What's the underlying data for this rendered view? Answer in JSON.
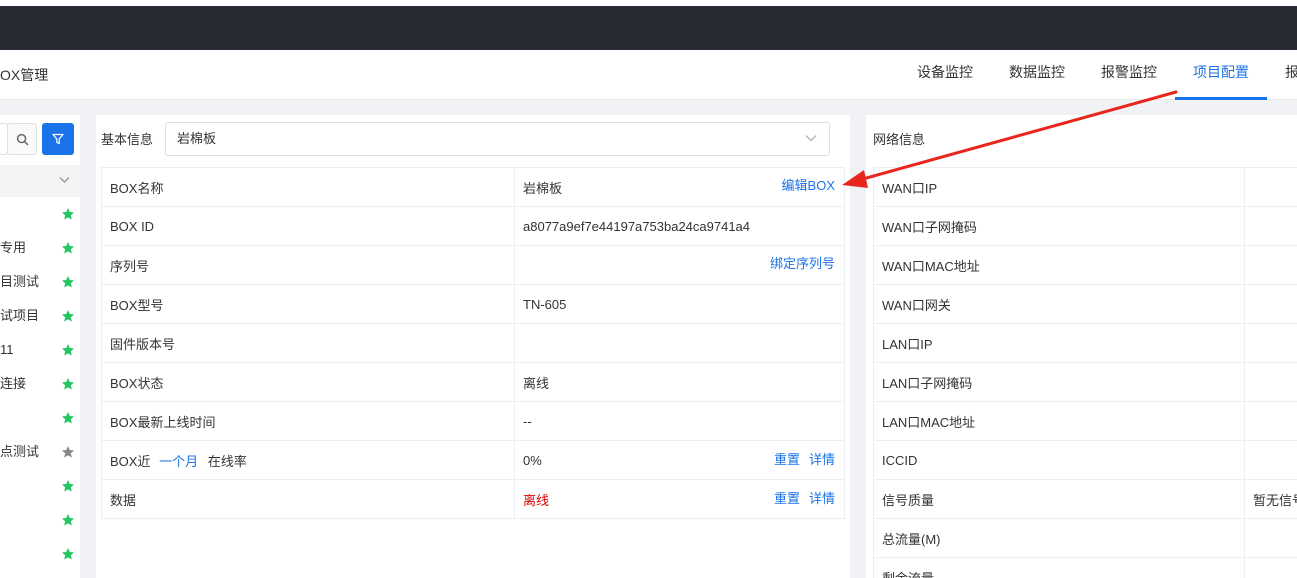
{
  "header": {
    "page_title": "OX管理",
    "tabs": [
      {
        "label": "设备监控"
      },
      {
        "label": "数据监控"
      },
      {
        "label": "报警监控"
      },
      {
        "label": "项目配置"
      },
      {
        "label": "报"
      }
    ],
    "active_tab": "项目配置",
    "accent_color": "#1a73e8"
  },
  "sidebar": {
    "projects": [
      {
        "name": "",
        "star": "green"
      },
      {
        "name": "专用",
        "star": "green"
      },
      {
        "name": "目测试",
        "star": "green"
      },
      {
        "name": "试项目",
        "star": "green"
      },
      {
        "name": "11",
        "star": "green"
      },
      {
        "name": "连接",
        "star": "green"
      },
      {
        "name": "",
        "star": "green"
      },
      {
        "name": "点测试",
        "star": "gray"
      },
      {
        "name": "",
        "star": "green"
      },
      {
        "name": "",
        "star": "green"
      },
      {
        "name": "",
        "star": "green"
      }
    ]
  },
  "basic": {
    "label": "基本信息",
    "selected": "岩棉板",
    "rows": [
      {
        "key": "BOX名称",
        "value": "岩棉板",
        "action": "编辑BOX"
      },
      {
        "key": "BOX ID",
        "value": "a8077a9ef7e44197a753ba24ca9741a4"
      },
      {
        "key": "序列号",
        "value": "",
        "action": "绑定序列号"
      },
      {
        "key": "BOX型号",
        "value": "TN-605"
      },
      {
        "key": "固件版本号",
        "value": ""
      },
      {
        "key": "BOX状态",
        "value": "离线",
        "value_color": "#dd0000"
      },
      {
        "key": "BOX最新上线时间",
        "value": "--"
      },
      {
        "key_prefix": "BOX近",
        "key_link": "一个月",
        "key_suffix": "在线率",
        "value": "0%",
        "actions": [
          "重置",
          "详情"
        ]
      },
      {
        "key": "数据",
        "value": "离线",
        "value_color": "#dd0000",
        "actions": [
          "重置",
          "详情"
        ]
      }
    ]
  },
  "network": {
    "label": "网络信息",
    "rows": [
      {
        "key": "WAN口IP",
        "value": ""
      },
      {
        "key": "WAN口子网掩码",
        "value": ""
      },
      {
        "key": "WAN口MAC地址",
        "value": ""
      },
      {
        "key": "WAN口网关",
        "value": ""
      },
      {
        "key": "LAN口IP",
        "value": ""
      },
      {
        "key": "LAN口子网掩码",
        "value": ""
      },
      {
        "key": "LAN口MAC地址",
        "value": ""
      },
      {
        "key": "ICCID",
        "value": ""
      },
      {
        "key": "信号质量",
        "value": "暂无信号"
      },
      {
        "key": "总流量(M)",
        "value": ""
      },
      {
        "key": "剩余流量",
        "value": ""
      }
    ]
  },
  "icons": {
    "search": "search-icon",
    "filter": "filter-icon",
    "chevron": "chevron-down-icon",
    "star": "star-icon",
    "annotation": "red-arrow-annotation"
  }
}
